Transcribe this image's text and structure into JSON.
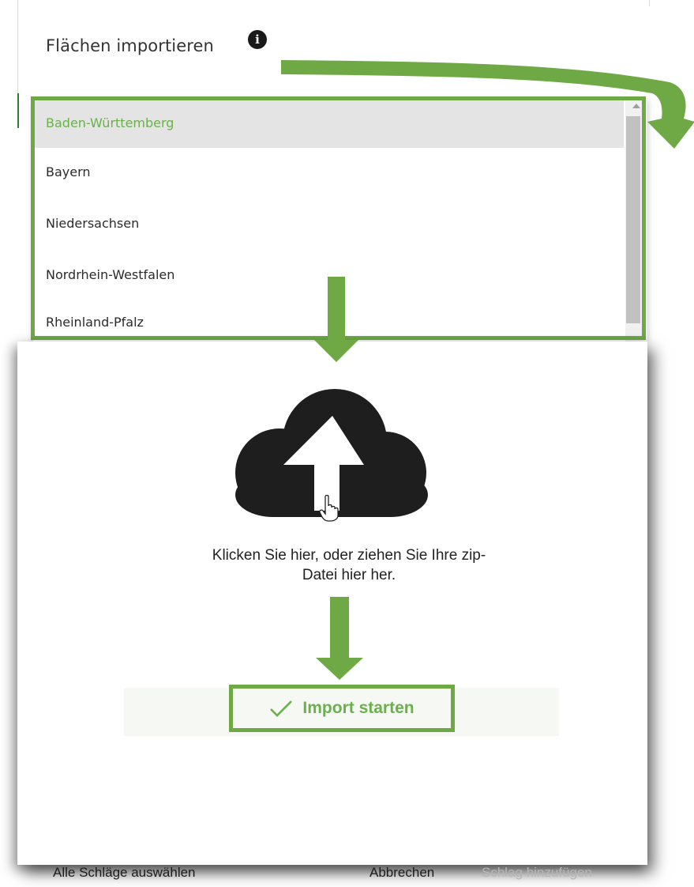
{
  "header": {
    "title": "Flächen importieren",
    "info_icon": "info-icon"
  },
  "dropdown": {
    "items": [
      {
        "label": "Baden-Württemberg",
        "selected": true
      },
      {
        "label": "Bayern",
        "selected": false
      },
      {
        "label": "Niedersachsen",
        "selected": false
      },
      {
        "label": "Nordrhein-Westfalen",
        "selected": false
      },
      {
        "label": "Rheinland-Pfalz",
        "selected": false
      }
    ]
  },
  "upload": {
    "icon": "cloud-upload-icon",
    "instruction_line1": "Klicken Sie hier, oder ziehen Sie Ihre zip-",
    "instruction_line2": "Datei hier her."
  },
  "import_button": {
    "label": "Import starten",
    "icon": "check-icon"
  },
  "footer": {
    "select_all": "Alle Schläge auswählen",
    "cancel": "Abbrechen",
    "add": "Schlag hinzufügen"
  },
  "colors": {
    "accent_green": "#6ea946",
    "selected_text": "#6ab04c",
    "disabled_text": "#b5b5b5",
    "icon_dark": "#1e1e1e"
  }
}
